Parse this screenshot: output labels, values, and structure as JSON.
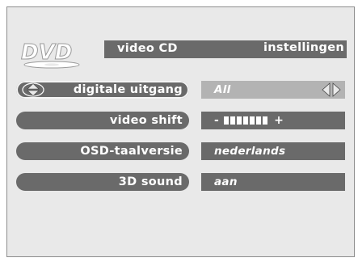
{
  "logo": {
    "text": "DVD"
  },
  "header": {
    "title": "video CD",
    "section": "instellingen"
  },
  "menu": [
    {
      "label": "digitale uitgang",
      "value": "All",
      "selected": true
    },
    {
      "label": "video shift",
      "value_type": "slider",
      "minus": "-",
      "plus": "+",
      "slider_level": 7
    },
    {
      "label": "OSD-taalversie",
      "value": "nederlands"
    },
    {
      "label": "3D sound",
      "value": "aan"
    }
  ],
  "colors": {
    "bar": "#6a6a6a",
    "selected_value": "#b3b3b3",
    "screen": "#e9e9e9",
    "text": "#ffffff"
  },
  "icons": {
    "updown": "up-down-arrows-icon",
    "leftright": "left-right-arrows-icon"
  }
}
